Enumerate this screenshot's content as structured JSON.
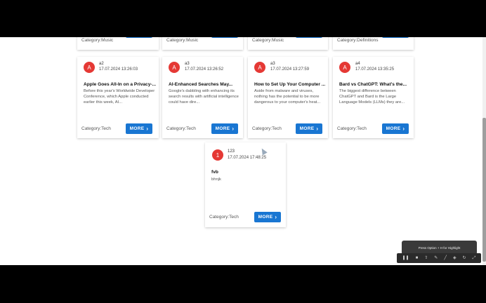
{
  "more_label": "MORE",
  "top_row": [
    {
      "category": "Category:Music"
    },
    {
      "category": "Category:Music"
    },
    {
      "category": "Category:Music"
    },
    {
      "category": "Category:Definitions"
    }
  ],
  "cards": [
    {
      "avatar": "A",
      "author": "a2",
      "date": "17.07.2024 13:26:03",
      "title": "Apple Goes All-In on a Privacy-...",
      "desc": "Before this year's Worldwide Developer Conference, which Apple conducted earlier this week, AI...",
      "category": "Category:Tech"
    },
    {
      "avatar": "A",
      "author": "a3",
      "date": "17.07.2024 13:26:52",
      "title": "AI-Enhanced Searches May...",
      "desc": "Google's dabbling with enhancing its search results with artificial intelligence could have dire...",
      "category": "Category:Tech"
    },
    {
      "avatar": "A",
      "author": "a3",
      "date": "17.07.2024 13:27:59",
      "title": "How to Set Up Your Computer ...",
      "desc": "Aside from malware and viruses, nothing has the potential to be more dangerous to your computer's heat...",
      "category": "Category:Tech"
    },
    {
      "avatar": "A",
      "author": "a4",
      "date": "17.07.2024 13:35:25",
      "title": "Bard vs ChatGPT: What's the...",
      "desc": "The biggest difference between ChatGPT and Bard is the Large Language Models (LLMs) they are...",
      "category": "Category:Tech"
    }
  ],
  "single_card": {
    "avatar": "1",
    "author": "123",
    "date": "17.07.2024 17:48:25",
    "title": "fvb",
    "desc": "bhnjk",
    "category": "Category:Tech"
  },
  "toolbar": {
    "tip": "Press Option + H for Highlight",
    "icons": [
      "pause-icon",
      "square-icon",
      "upload-icon",
      "pen-icon",
      "line-icon",
      "eraser-icon",
      "refresh-icon",
      "expand-icon"
    ]
  },
  "colors": {
    "accent": "#1976d2",
    "avatar": "#e53935"
  }
}
